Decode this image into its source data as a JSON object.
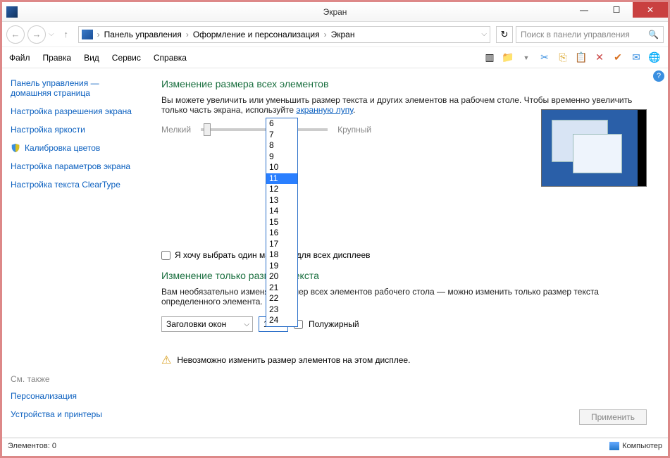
{
  "window": {
    "title": "Экран"
  },
  "breadcrumb": {
    "root": "Панель управления",
    "mid": "Оформление и персонализация",
    "leaf": "Экран"
  },
  "search": {
    "placeholder": "Поиск в панели управления"
  },
  "menu": {
    "file": "Файл",
    "edit": "Правка",
    "view": "Вид",
    "service": "Сервис",
    "help": "Справка"
  },
  "sidebar": {
    "home": "Панель управления — домашняя страница",
    "resolution": "Настройка разрешения экрана",
    "brightness": "Настройка яркости",
    "calibrate": "Калибровка цветов",
    "params": "Настройка параметров экрана",
    "cleartype": "Настройка текста ClearType",
    "seealso_hdr": "См. также",
    "personalization": "Персонализация",
    "devices": "Устройства и принтеры"
  },
  "main": {
    "h1": "Изменение размера всех элементов",
    "p1a": "Вы можете увеличить или уменьшить размер текста и других элементов на рабочем столе. Чтобы временно увеличить только часть экрана, используйте ",
    "p1_link": "экранную лупу",
    "slider_small": "Мелкий",
    "slider_large": "Крупный",
    "cb_onescale": "Я хочу выбрать один масштаб для всех дисплеев",
    "h2": "Изменение только размера текста",
    "p2": "Вам необязательно изменять размер всех элементов рабочего стола — можно изменить только размер текста определенного элемента.",
    "sel_titles": "Заголовки окон",
    "sel_size": "11",
    "cb_bold": "Полужирный",
    "warn": "Невозможно изменить размер элементов на этом дисплее.",
    "apply": "Применить"
  },
  "dropdown": {
    "options": [
      "6",
      "7",
      "8",
      "9",
      "10",
      "11",
      "12",
      "13",
      "14",
      "15",
      "16",
      "17",
      "18",
      "19",
      "20",
      "21",
      "22",
      "23",
      "24"
    ],
    "selected": "11"
  },
  "status": {
    "items": "Элементов: 0",
    "computer": "Компьютер"
  }
}
